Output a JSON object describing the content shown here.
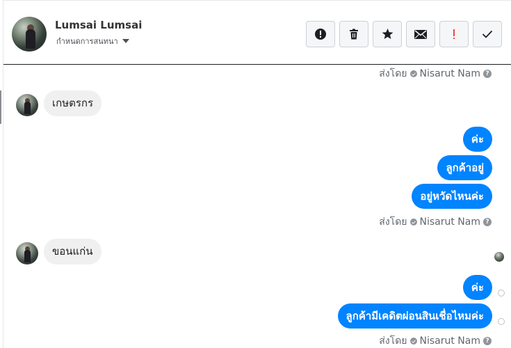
{
  "header": {
    "name": "Lumsai Lumsai",
    "subtitle": "กำหนดการสนทนา",
    "toolbar": [
      {
        "icon": "exclamation-circle-icon"
      },
      {
        "icon": "trash-icon"
      },
      {
        "icon": "star-icon"
      },
      {
        "icon": "envelope-icon"
      },
      {
        "icon": "red-exclamation-icon",
        "color": "#fa3e3e"
      },
      {
        "icon": "checkmark-icon"
      }
    ]
  },
  "messages": {
    "sent_by_prefix": "ส่งโดย",
    "sender": "Nisarut Nam",
    "incoming_1": "เกษตรกร",
    "outgoing_1": "ค่ะ",
    "outgoing_2": "ลูกค้าอยู่",
    "outgoing_3": "อยู่หวัดไหนค่ะ",
    "incoming_2": "ขอนแก่น",
    "outgoing_4": "ค่ะ",
    "outgoing_5": "ลูกค้ามีเคดิตผ่อนสินเชื่อไหมค่ะ"
  },
  "colors": {
    "outgoing_bubble": "#0084ff",
    "incoming_bubble": "#f1f0f0",
    "flag_icon": "#fa3e3e"
  }
}
